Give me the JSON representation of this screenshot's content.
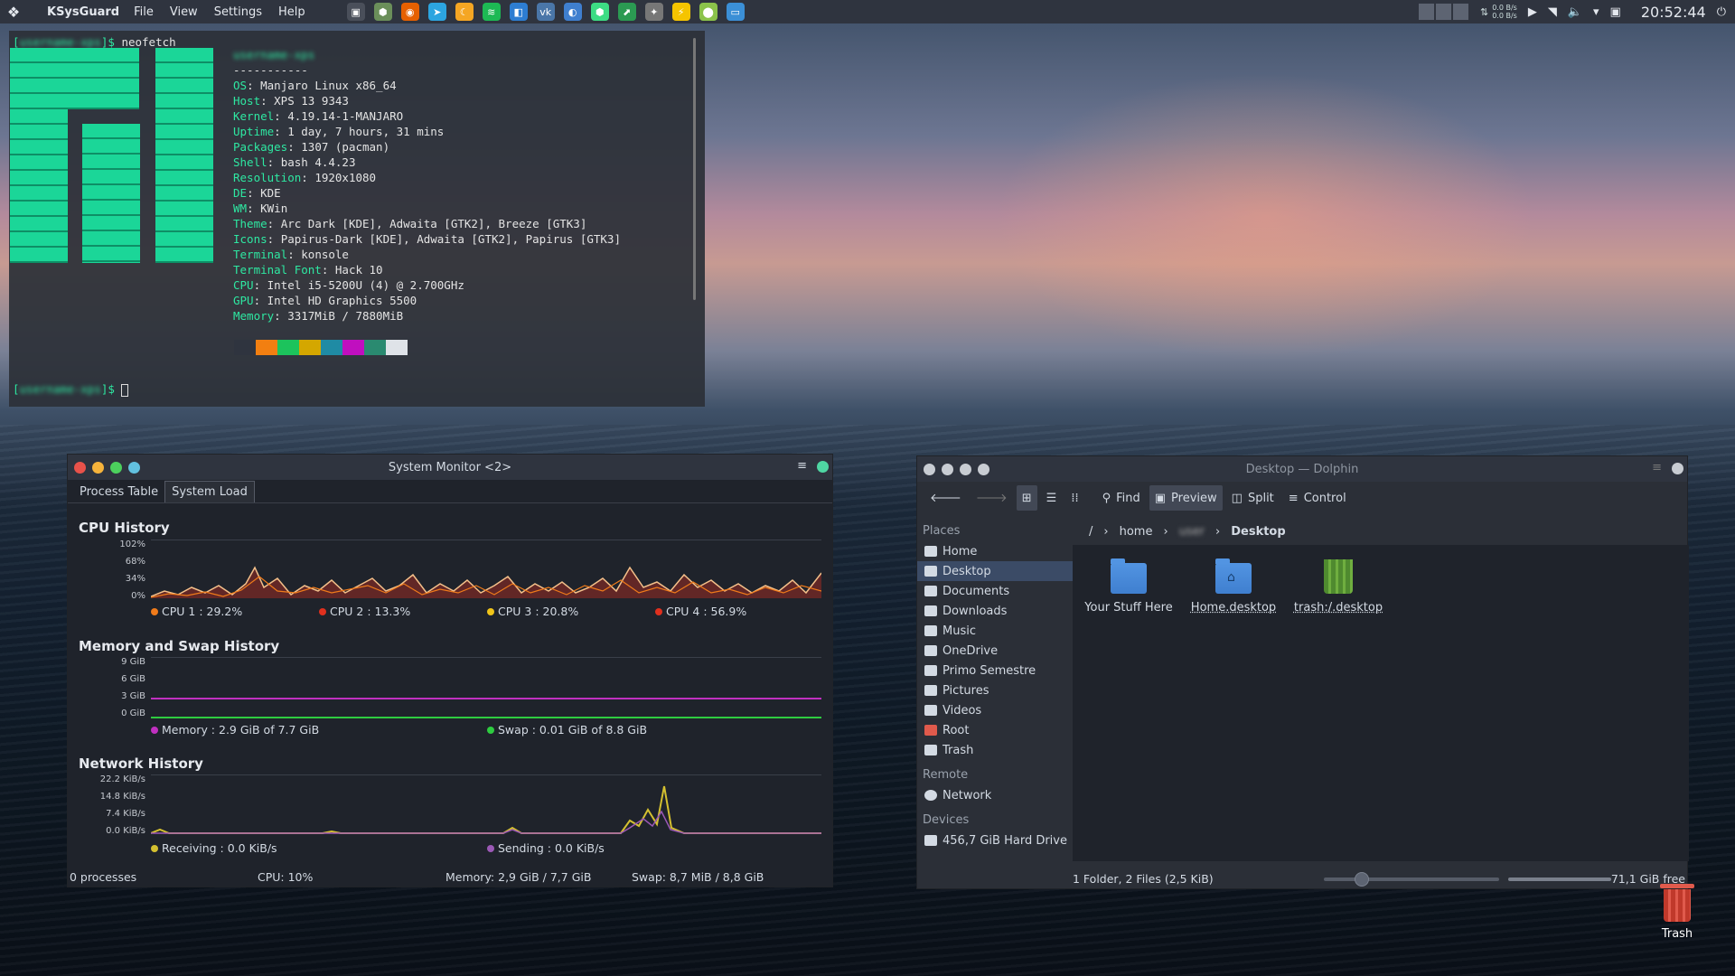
{
  "panel": {
    "app_name": "KSysGuard",
    "menus": [
      "File",
      "View",
      "Settings",
      "Help"
    ],
    "net_down": "0.0 B/s",
    "net_up": "0.0 B/s",
    "clock": "20:52:44",
    "launchers": [
      {
        "icon": "terminal-icon",
        "glyph": "▣",
        "color": "#4a4f5a"
      },
      {
        "icon": "android-icon",
        "glyph": "⬢",
        "color": "#6b8f5a"
      },
      {
        "icon": "firefox-icon",
        "glyph": "◉",
        "color": "#e66000"
      },
      {
        "icon": "telegram-icon",
        "glyph": "➤",
        "color": "#2ca5e0"
      },
      {
        "icon": "moon-icon",
        "glyph": "☾",
        "color": "#f5a623"
      },
      {
        "icon": "spotify-icon",
        "glyph": "≋",
        "color": "#1db954"
      },
      {
        "icon": "vscode-icon",
        "glyph": "◧",
        "color": "#2d7dd2"
      },
      {
        "icon": "vk-icon",
        "glyph": "vk",
        "color": "#4a76a8"
      },
      {
        "icon": "app-icon",
        "glyph": "◐",
        "color": "#3f7fcf"
      },
      {
        "icon": "android-studio-icon",
        "glyph": "⬢",
        "color": "#3ddc84"
      },
      {
        "icon": "ksysguard-icon",
        "glyph": "⬈",
        "color": "#2b9a52"
      },
      {
        "icon": "tools-icon",
        "glyph": "✦",
        "color": "#777"
      },
      {
        "icon": "lightning-icon",
        "glyph": "⚡",
        "color": "#f5c400"
      },
      {
        "icon": "location-icon",
        "glyph": "⬤",
        "color": "#8bc34a"
      },
      {
        "icon": "monitor-icon",
        "glyph": "▭",
        "color": "#3b8fd6"
      }
    ]
  },
  "konsole": {
    "command": "neofetch",
    "prompt_end": "]$",
    "user_host_hidden": "username-xps",
    "separator": "-----------",
    "info": [
      {
        "k": "OS",
        "v": ": Manjaro Linux x86_64"
      },
      {
        "k": "Host",
        "v": ": XPS 13 9343"
      },
      {
        "k": "Kernel",
        "v": ": 4.19.14-1-MANJARO"
      },
      {
        "k": "Uptime",
        "v": ": 1 day, 7 hours, 31 mins"
      },
      {
        "k": "Packages",
        "v": ": 1307 (pacman)"
      },
      {
        "k": "Shell",
        "v": ": bash 4.4.23"
      },
      {
        "k": "Resolution",
        "v": ": 1920x1080"
      },
      {
        "k": "DE",
        "v": ": KDE"
      },
      {
        "k": "WM",
        "v": ": KWin"
      },
      {
        "k": "Theme",
        "v": ": Arc Dark [KDE], Adwaita [GTK2], Breeze [GTK3]"
      },
      {
        "k": "Icons",
        "v": ": Papirus-Dark [KDE], Adwaita [GTK2], Papirus [GTK3]"
      },
      {
        "k": "Terminal",
        "v": ": konsole"
      },
      {
        "k": "Terminal Font",
        "v": ": Hack 10"
      },
      {
        "k": "CPU",
        "v": ": Intel i5-5200U (4) @ 2.700GHz"
      },
      {
        "k": "GPU",
        "v": ": Intel HD Graphics 5500"
      },
      {
        "k": "Memory",
        "v": ": 3317MiB / 7880MiB"
      }
    ],
    "swatches": [
      "#2f343f",
      "#f27f11",
      "#1cc35c",
      "#d4a700",
      "#1f8ba4",
      "#c00fbf",
      "#2a8a70",
      "#dfe3e8"
    ]
  },
  "sysmon": {
    "title": "System Monitor <2>",
    "tabs": [
      "Process Table",
      "System Load"
    ],
    "cpu": {
      "title": "CPU History",
      "ticks": [
        "102%",
        "68%",
        "34%",
        "0%"
      ],
      "legend": [
        {
          "label": "CPU 1 : 29.2%",
          "color": "#f07b1a"
        },
        {
          "label": "CPU 2 : 13.3%",
          "color": "#e0301e"
        },
        {
          "label": "CPU 3 : 20.8%",
          "color": "#f0c419"
        },
        {
          "label": "CPU 4 : 56.9%",
          "color": "#e0301e"
        }
      ]
    },
    "mem": {
      "title": "Memory and Swap History",
      "ticks": [
        "9 GiB",
        "6 GiB",
        "3 GiB",
        "0 GiB"
      ],
      "legend": [
        {
          "label": "Memory : 2.9 GiB of 7.7 GiB",
          "color": "#c030c0"
        },
        {
          "label": "Swap : 0.01 GiB of 8.8 GiB",
          "color": "#2ecc40"
        }
      ]
    },
    "net": {
      "title": "Network History",
      "ticks": [
        "22.2 KiB/s",
        "14.8 KiB/s",
        "7.4 KiB/s",
        "0.0 KiB/s"
      ],
      "legend": [
        {
          "label": "Receiving : 0.0 KiB/s",
          "color": "#d4c030"
        },
        {
          "label": "Sending : 0.0 KiB/s",
          "color": "#9b59b6"
        }
      ]
    },
    "status": {
      "processes": "0 processes",
      "cpu": "CPU: 10%",
      "memory": "Memory: 2,9 GiB / 7,7 GiB",
      "swap": "Swap: 8,7 MiB / 8,8 GiB"
    }
  },
  "dolphin": {
    "title": "Desktop — Dolphin",
    "toolbar": {
      "find": "Find",
      "preview": "Preview",
      "split": "Split",
      "control": "Control"
    },
    "places_header": "Places",
    "places": [
      "Home",
      "Desktop",
      "Documents",
      "Downloads",
      "Music",
      "OneDrive",
      "Primo Semestre",
      "Pictures",
      "Videos",
      "Root",
      "Trash"
    ],
    "remote_header": "Remote",
    "remote": [
      "Network"
    ],
    "devices_header": "Devices",
    "devices": [
      "456,7 GiB Hard Drive"
    ],
    "crumbs": {
      "root": "/",
      "home": "home",
      "user_hidden": "user",
      "current": "Desktop"
    },
    "files": [
      {
        "name": "Your Stuff Here",
        "kind": "folder"
      },
      {
        "name": "Home.desktop",
        "kind": "home-folder"
      },
      {
        "name": "trash:/.desktop",
        "kind": "trash"
      }
    ],
    "status": "1 Folder, 2 Files (2,5 KiB)",
    "free": "71,1 GiB free"
  },
  "desktop": {
    "trash_label": "Trash"
  }
}
